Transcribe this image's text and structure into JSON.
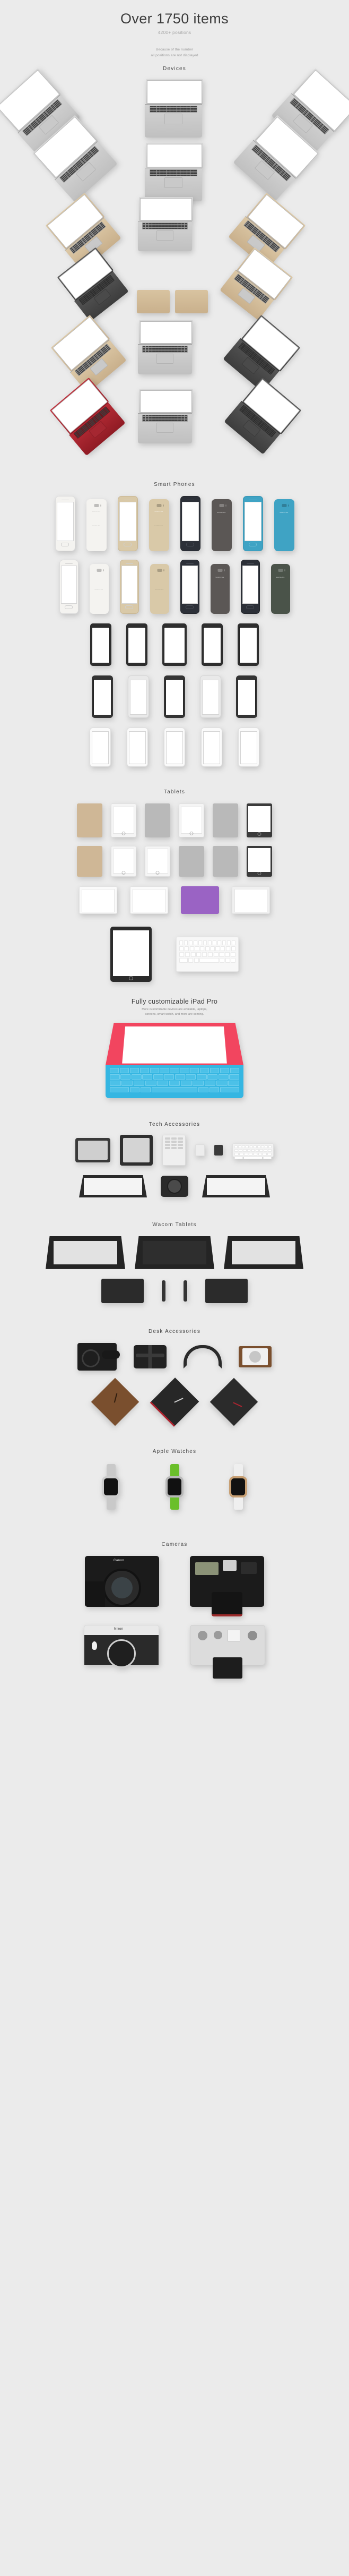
{
  "hero": {
    "title": "Over 1750 items",
    "subtitle": "4200+ positions",
    "note_line1": "Because of the number",
    "note_line2": "all positions are not displayed"
  },
  "sections": [
    {
      "id": "devices",
      "title": "Devices"
    },
    {
      "id": "smart-phones",
      "title": "Smart Phones"
    },
    {
      "id": "tablets",
      "title": "Tablets"
    },
    {
      "id": "tech-accessories",
      "title": "Tech Accessories"
    },
    {
      "id": "wacom-tablets",
      "title": "Wacom Tablets"
    },
    {
      "id": "desk-accessories",
      "title": "Desk Accessories"
    },
    {
      "id": "apple-watches",
      "title": "Apple Watches"
    },
    {
      "id": "cameras",
      "title": "Cameras"
    }
  ],
  "ipad_pro": {
    "title": "Fully customizable iPad Pro",
    "note_line1": "More customizable devices are available, laptops,",
    "note_line2": "screens, smart watch, and more are coming.",
    "screen_color": "#f2455f",
    "keyboard_color": "#35b6e2"
  },
  "brands": {
    "samsung": "SAMSUNG",
    "canon": "Canon",
    "nikon": "Nikon"
  },
  "colors": {
    "background": "#ebebeb",
    "heading": "#3c3c3c",
    "muted": "#a9a9a9",
    "laptop_silver": "#cfcfcf",
    "laptop_space_gray": "#4a4a4a",
    "laptop_gold": "#d8c3a0",
    "laptop_rose": "#e0b9ad",
    "laptop_red": "#b02430",
    "phone_white": "#f4f3f0",
    "phone_gold": "#d9c9a8",
    "phone_black": "#2c3038",
    "phone_gray": "#5b5755",
    "phone_blue": "#3fa3c4",
    "phone_green": "#4a5349",
    "tablet_gold": "#cfb796",
    "tablet_white": "#f5f5f5",
    "tablet_silver": "#b9b9b9",
    "tablet_purple": "#9a63c4",
    "tablet_dark": "#3a3a3a",
    "watch_silver": "#c9c9c9",
    "watch_green": "#6abf2a",
    "watch_gold": "#c79f73",
    "watch_white": "#efefef",
    "wood": "#7a4f2e"
  },
  "device_groups": {
    "laptops_top": [
      "silver",
      "silver",
      "silver",
      "silver",
      "silver",
      "silver"
    ],
    "laptops_gold": [
      "gold",
      "silver",
      "gold"
    ],
    "laptops_mid": [
      "silver",
      "gold"
    ],
    "laptops_color": [
      "gold",
      "silver",
      "space-gray",
      "red",
      "silver",
      "space-gray"
    ],
    "phones_row1": [
      "white",
      "white",
      "gold",
      "gold",
      "black",
      "gray",
      "blue",
      "blue"
    ],
    "phones_row2": [
      "white",
      "white",
      "gold",
      "gold",
      "black",
      "gray",
      "black",
      "green"
    ],
    "phones_row3": [
      "black",
      "black",
      "black",
      "black",
      "black"
    ],
    "phones_row4": [
      "black",
      "white",
      "black",
      "white",
      "black"
    ],
    "phones_row5": [
      "white",
      "white",
      "white",
      "white",
      "white"
    ],
    "tablets_row1": [
      "gold",
      "white",
      "silver",
      "white",
      "silver",
      "dark"
    ],
    "tablets_row2": [
      "gold",
      "white",
      "white",
      "silver",
      "silver",
      "dark"
    ],
    "tablets_row3": [
      "white",
      "white",
      "purple",
      "dark"
    ],
    "watches": [
      "silver",
      "green",
      "gold"
    ]
  }
}
